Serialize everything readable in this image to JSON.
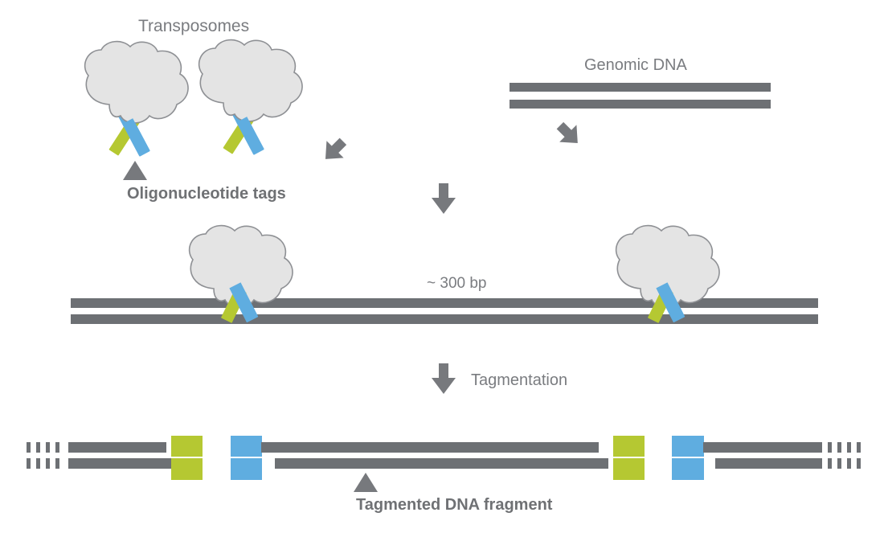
{
  "diagram": {
    "title_text": "Transposomes",
    "labels": {
      "transposomes": "Transposomes",
      "genomic_dna": "Genomic DNA",
      "oligonucleotide_tags": "Oligonucleotide tags",
      "fragment_size": "~ 300 bp",
      "tagmentation": "Tagmentation",
      "tagmented_fragment": "Tagmented DNA fragment"
    },
    "colors": {
      "background": "#ffffff",
      "dna_strand": "#6d7074",
      "transposome_fill": "#e4e4e4",
      "transposome_stroke": "#8e9094",
      "oligo_blue": "#5fade0",
      "oligo_green": "#b5c832",
      "arrow": "#77797d",
      "text": "#7a7c80",
      "text_bold": "#6f7174"
    },
    "icons": {
      "arrow_down": "arrow-down-icon",
      "arrow_diagonal_left": "arrow-diagonal-down-right-icon",
      "arrow_diagonal_right": "arrow-diagonal-down-left-icon",
      "pointer_up": "triangle-pointer-up-icon"
    },
    "stages": [
      {
        "name": "reagents",
        "items": [
          "transposome-1",
          "transposome-2",
          "genomic-dna"
        ]
      },
      {
        "name": "binding",
        "items": [
          "bound-transposome-left",
          "bound-transposome-right",
          "genomic-dna-duplex"
        ]
      },
      {
        "name": "tagmented-fragments",
        "items": [
          "fragment-left",
          "fragment-middle",
          "fragment-right"
        ]
      }
    ],
    "fragments": [
      {
        "id": "fragment-left",
        "left_end": "dashed",
        "right_end": "green-tag",
        "tag_color": "green"
      },
      {
        "id": "fragment-middle",
        "left_end": "blue-tag",
        "right_end": "green-tag",
        "tag_color": "blue-green"
      },
      {
        "id": "fragment-right",
        "left_end": "blue-tag",
        "right_end": "dashed",
        "tag_color": "blue"
      }
    ]
  }
}
